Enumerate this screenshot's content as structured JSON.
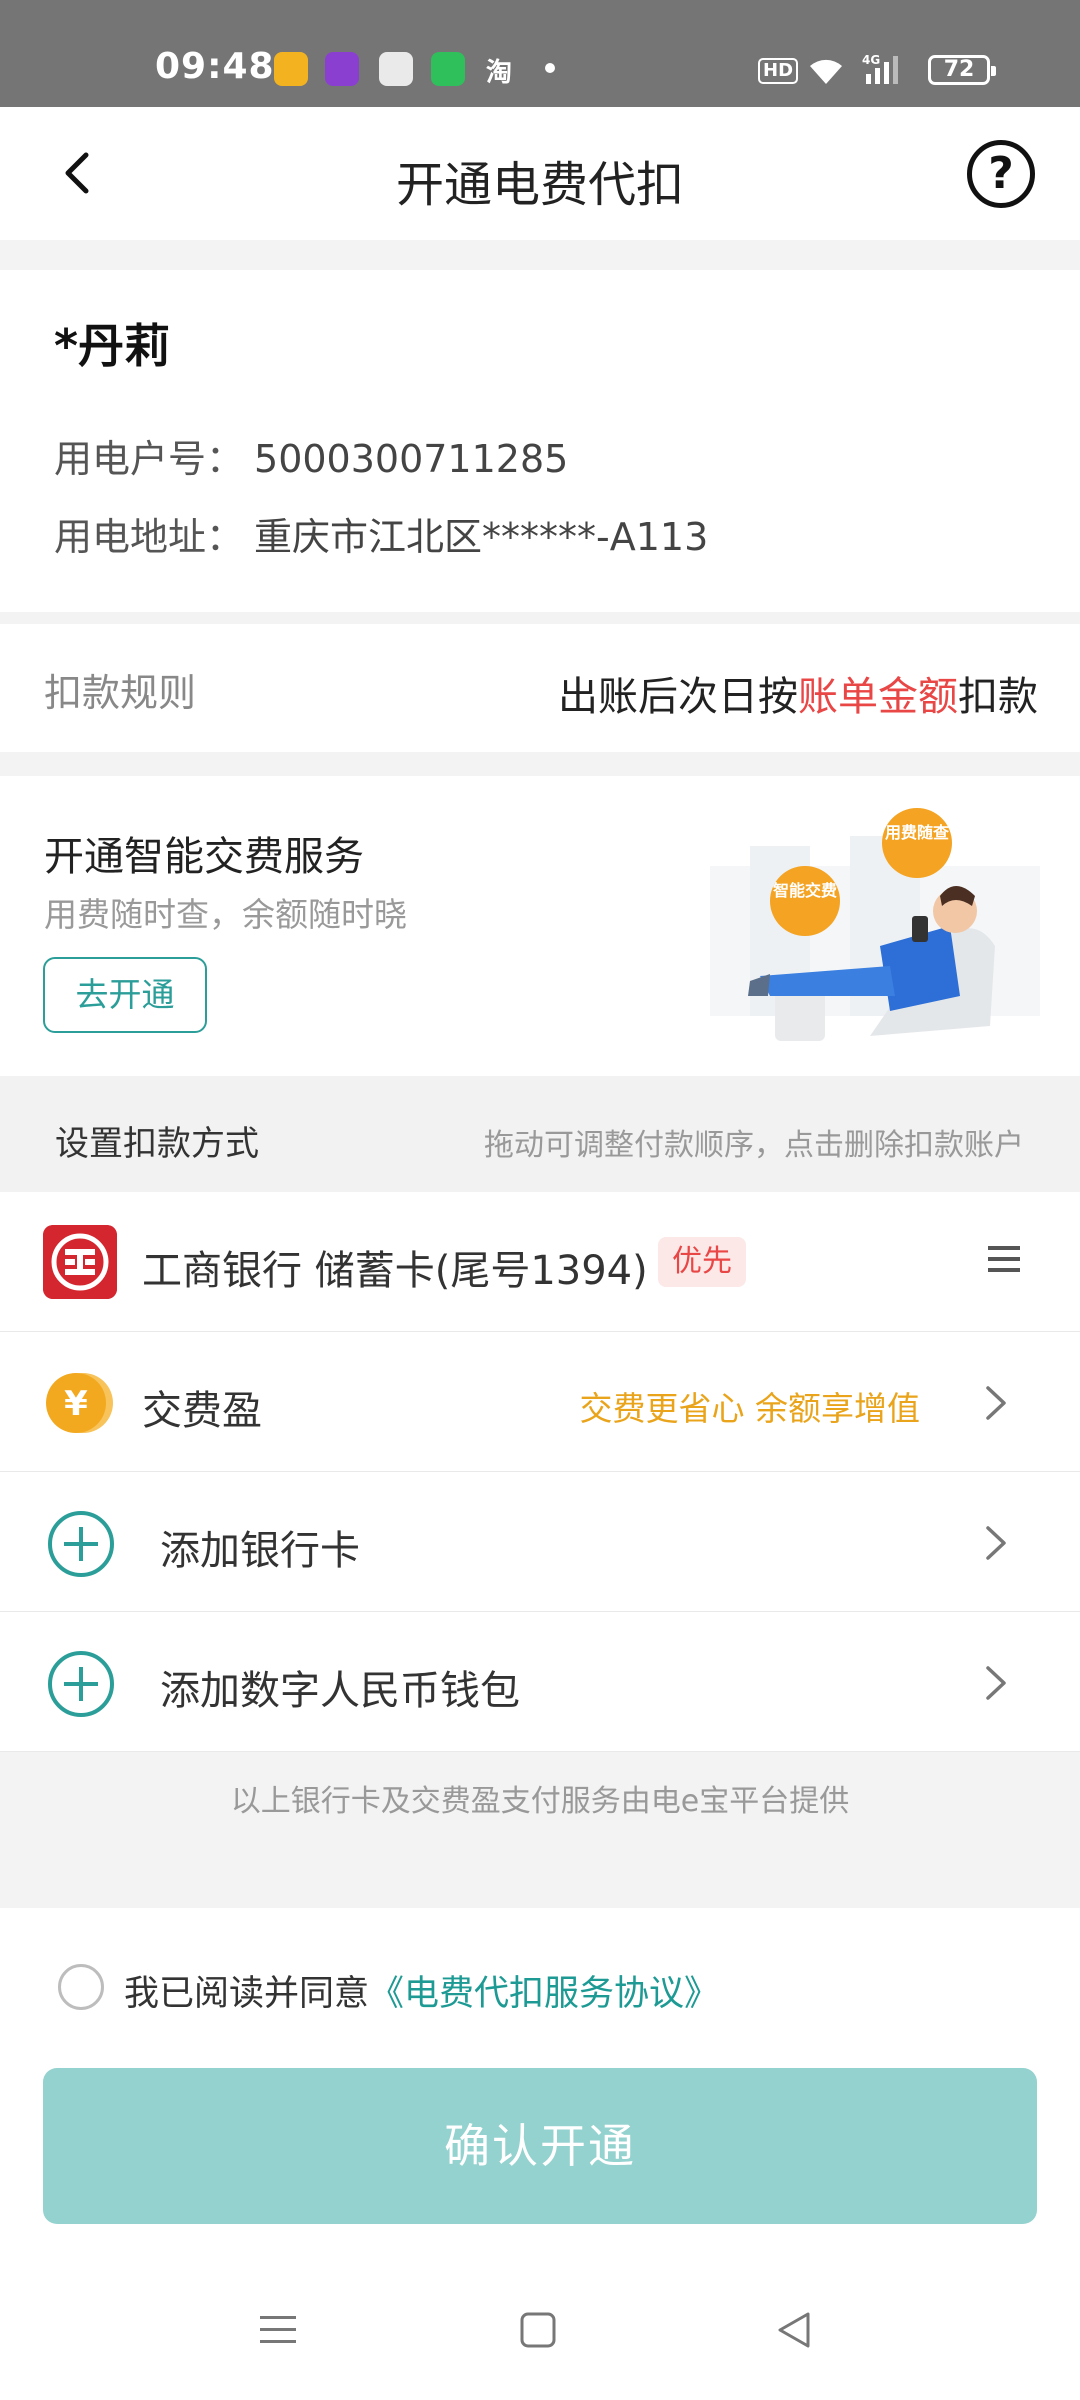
{
  "status_bar": {
    "time": "09:48",
    "taobao": "淘",
    "hd": "HD",
    "network": "4G",
    "battery": "72"
  },
  "header": {
    "title": "开通电费代扣",
    "help_icon": "?"
  },
  "account": {
    "name": "*丹莉",
    "number_label": "用电户号：",
    "number": "5000300711285",
    "address_label": "用电地址：",
    "address": "重庆市江北区******-A113"
  },
  "rule": {
    "label": "扣款规则",
    "value_prefix": "出账后次日按",
    "value_highlight": "账单金额",
    "value_suffix": "扣款"
  },
  "smart_service": {
    "title": "开通智能交费服务",
    "subtitle": "用费随时查，余额随时晓",
    "button": "去开通",
    "bubble1": "智能交费",
    "bubble2": "用费随查"
  },
  "payment": {
    "title": "设置扣款方式",
    "hint": "拖动可调整付款顺序，点击删除扣款账户",
    "bank_card": "工商银行  储蓄卡(尾号1394)",
    "priority_badge": "优先",
    "jiaofeiying": "交费盈",
    "jiaofeiying_tag": "交费更省心 余额享增值",
    "add_bank": "添加银行卡",
    "add_wallet": "添加数字人民币钱包",
    "provider_note": "以上银行卡及交费盈支付服务由电e宝平台提供"
  },
  "agreement": {
    "text": "我已阅读并同意",
    "link": "《电费代扣服务协议》"
  },
  "confirm_button": "确认开通",
  "colors": {
    "accent": "#2b9e99",
    "highlight": "#e94646",
    "gold": "#e9a41b",
    "button_disabled": "#93d2cf",
    "icbc_red": "#d4262f"
  }
}
